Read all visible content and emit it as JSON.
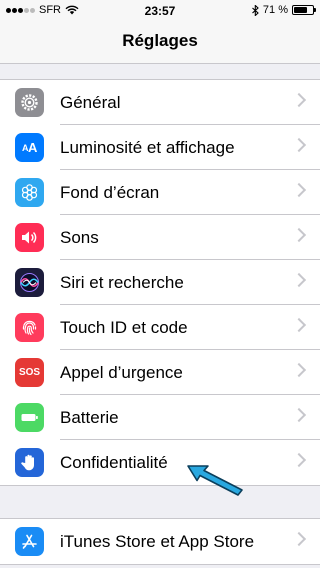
{
  "status_bar": {
    "carrier": "SFR",
    "time": "23:57",
    "battery_percent": "71 %",
    "battery_level": 0.71
  },
  "navbar": {
    "title": "Réglages"
  },
  "groups": [
    {
      "items": [
        {
          "label": "Général",
          "icon": "gear-icon",
          "color": "#8e8e93"
        },
        {
          "label": "Luminosité et affichage",
          "icon": "text-size-icon",
          "icon_text": "AA",
          "color": "#007aff"
        },
        {
          "label": "Fond d’écran",
          "icon": "flower-icon",
          "color": "#2fa8f0"
        },
        {
          "label": "Sons",
          "icon": "speaker-icon",
          "color": "#ff2d55"
        },
        {
          "label": "Siri et recherche",
          "icon": "siri-icon",
          "color": "#1c1c3c"
        },
        {
          "label": "Touch ID et code",
          "icon": "fingerprint-icon",
          "color": "#ff3b5c"
        },
        {
          "label": "Appel d’urgence",
          "icon": "sos-icon",
          "icon_text": "SOS",
          "color": "#e53935"
        },
        {
          "label": "Batterie",
          "icon": "battery-icon",
          "color": "#4cd964"
        },
        {
          "label": "Confidentialité",
          "icon": "hand-icon",
          "color": "#2466d8"
        }
      ]
    },
    {
      "items": [
        {
          "label": "iTunes Store et App Store",
          "icon": "app-store-icon",
          "color": "#1a8cf5"
        }
      ]
    }
  ],
  "annotation": {
    "icon": "pointer-arrow-icon",
    "color": "#29a8e0"
  }
}
